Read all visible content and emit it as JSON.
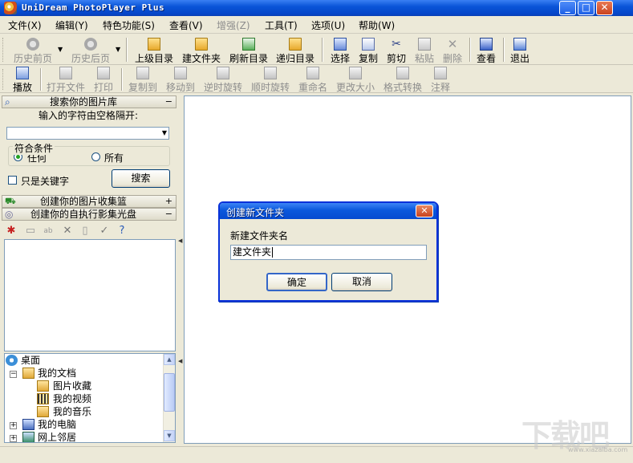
{
  "window": {
    "title": "UniDream PhotoPlayer Plus"
  },
  "menu": [
    "文件(X)",
    "编辑(Y)",
    "特色功能(S)",
    "查看(V)",
    "增强(Z)",
    "工具(T)",
    "选项(U)",
    "帮助(W)"
  ],
  "toolbar1": {
    "back": "历史前页",
    "forward": "历史后页",
    "up": "上级目录",
    "new_folder": "建文件夹",
    "refresh": "刷新目录",
    "recursive": "递归目录",
    "select": "选择",
    "copy": "复制",
    "cut": "剪切",
    "paste": "粘贴",
    "delete": "删除",
    "view": "查看",
    "exit": "退出"
  },
  "toolbar2": {
    "play": "播放",
    "open_file": "打开文件",
    "print": "打印",
    "copy_to": "复制到",
    "move_to": "移动到",
    "rotate_ccw": "逆时旋转",
    "rotate_cw": "顺时旋转",
    "rename": "重命名",
    "resize": "更改大小",
    "convert": "格式转换",
    "annotate": "注释"
  },
  "search_panel": {
    "header": "搜索你的图片库",
    "toggle": "−",
    "hint": "输入的字符由空格隔开:",
    "query": "",
    "match_group": "符合条件",
    "option_any": "任何",
    "option_all": "所有",
    "keywords_only": "只是关键字",
    "search_button": "搜索"
  },
  "basket_panel": {
    "header": "创建你的图片收集篮",
    "toggle": "+"
  },
  "disc_panel": {
    "header": "创建你的自执行影集光盘",
    "toggle": "−"
  },
  "tree": {
    "desktop": "桌面",
    "my_documents": "我的文档",
    "pictures": "图片收藏",
    "videos": "我的视频",
    "music": "我的音乐",
    "my_computer": "我的电脑",
    "network": "网上邻居"
  },
  "dialog": {
    "title": "创建新文件夹",
    "label": "新建文件夹名",
    "value": "建文件夹",
    "ok": "确定",
    "cancel": "取消"
  },
  "watermark": {
    "text": "下载吧",
    "url": "www.xiazaiba.com"
  }
}
